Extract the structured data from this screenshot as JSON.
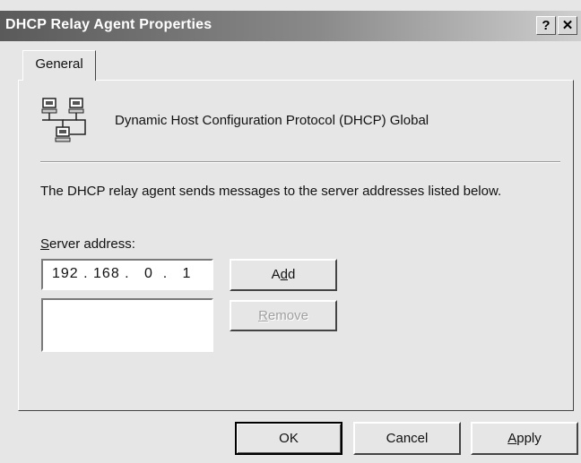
{
  "window": {
    "title": "DHCP Relay Agent Properties",
    "help_glyph": "?",
    "close_glyph": "✕"
  },
  "tabs": [
    {
      "label": "General",
      "selected": true
    }
  ],
  "general": {
    "protocol_icon": "network-computers-icon",
    "protocol_name": "Dynamic Host Configuration Protocol (DHCP) Global",
    "description": "The DHCP relay agent sends messages to the server addresses listed below.",
    "server_address_label_mnemonic": "S",
    "server_address_label_rest": "erver address:",
    "server_address_value": "192 . 168 .   0  .   1",
    "server_list": [],
    "add_button_pre": "A",
    "add_button_mnemonic": "d",
    "add_button_post": "d",
    "remove_button_mnemonic": "R",
    "remove_button_rest": "emove"
  },
  "footer": {
    "ok_label": "OK",
    "cancel_label": "Cancel",
    "apply_mnemonic": "A",
    "apply_rest": "pply"
  }
}
